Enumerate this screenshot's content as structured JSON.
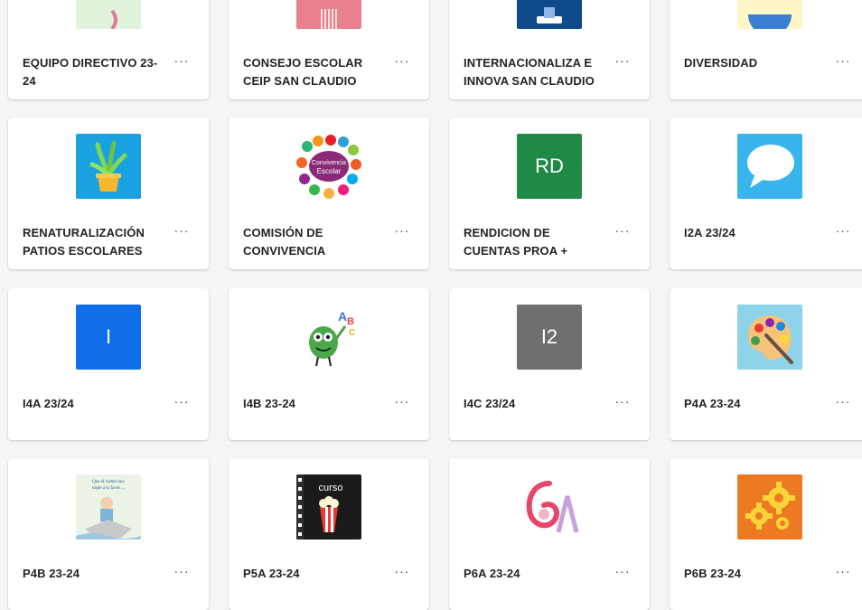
{
  "teams": [
    {
      "name": "EQUIPO DIRECTIVO 23-24",
      "more": "···",
      "thumb": {
        "kind": "partial",
        "color": "#e0f2dc",
        "accent": "#e07a9a"
      }
    },
    {
      "name": "CONSEJO ESCOLAR CEIP SAN CLAUDIO",
      "more": "···",
      "thumb": {
        "kind": "partial",
        "color": "#e9808b",
        "accent": "#ffffff"
      }
    },
    {
      "name": "INTERNACIONALIZA E INNOVA SAN CLAUDIO",
      "more": "···",
      "thumb": {
        "kind": "partial",
        "color": "#0f4a8a",
        "accent": "#ffffff"
      }
    },
    {
      "name": "DIVERSIDAD",
      "more": "···",
      "thumb": {
        "kind": "partial",
        "color": "#fff6c8",
        "accent": "#3b7fd4"
      }
    },
    {
      "name": "RENATURALIZACIÓN PATIOS ESCOLARES",
      "more": "···",
      "thumb": {
        "kind": "plant-icon",
        "color": "#1aa1e0"
      }
    },
    {
      "name": "COMISIÓN DE CONVIVENCIA",
      "more": "···",
      "thumb": {
        "kind": "hands-logo",
        "color": "#ffffff",
        "label": "Convivencia Escolar"
      }
    },
    {
      "name": "RENDICION DE CUENTAS PROA +",
      "more": "···",
      "thumb": {
        "kind": "initials",
        "color": "#1e8a46",
        "text": "RD"
      }
    },
    {
      "name": "I2A 23/24",
      "more": "···",
      "thumb": {
        "kind": "speech-icon",
        "color": "#39b5ee"
      }
    },
    {
      "name": "I4A 23/24",
      "more": "···",
      "thumb": {
        "kind": "initials",
        "color": "#0f6ee8",
        "text": "I"
      }
    },
    {
      "name": "I4B 23-24",
      "more": "···",
      "thumb": {
        "kind": "monster-abc",
        "color": "#ffffff"
      }
    },
    {
      "name": "I4C 23/24",
      "more": "···",
      "thumb": {
        "kind": "initials",
        "color": "#6f6f6f",
        "text": "I2"
      }
    },
    {
      "name": "P4A 23-24",
      "more": "···",
      "thumb": {
        "kind": "palette-icon",
        "color": "#8ed3ea"
      }
    },
    {
      "name": "P4B 23-24",
      "more": "···",
      "thumb": {
        "kind": "book-cover",
        "color": "#eaf3e6",
        "label": "Que el viento hoy sople a tu favor ..."
      }
    },
    {
      "name": "P5A 23-24",
      "more": "···",
      "thumb": {
        "kind": "popcorn-board",
        "color": "#1b1b1b",
        "label": "curso"
      }
    },
    {
      "name": "P6A 23-24",
      "more": "···",
      "thumb": {
        "kind": "sixa-art",
        "color": "#ffffff"
      }
    },
    {
      "name": "P6B 23-24",
      "more": "···",
      "thumb": {
        "kind": "gears-icon",
        "color": "#ec7a23"
      }
    }
  ]
}
